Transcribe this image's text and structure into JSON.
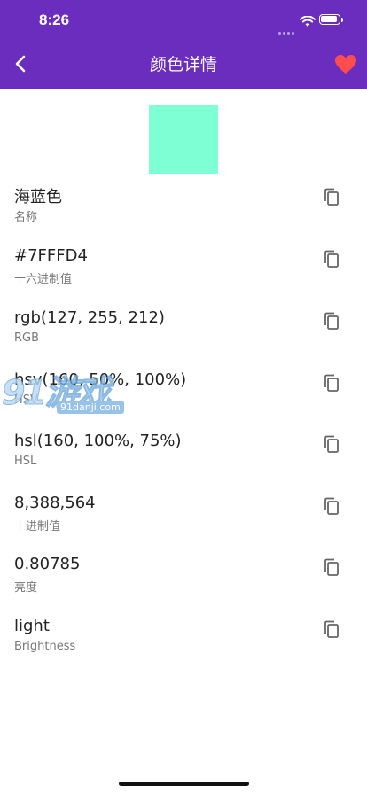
{
  "status_bar": {
    "time": "8:26"
  },
  "header": {
    "title": "颜色详情",
    "heart_color": "#ff4d4d",
    "background": "#6a2dbd"
  },
  "color": {
    "swatch_hex": "#7FFFD4"
  },
  "details": [
    {
      "value": "海蓝色",
      "label": "名称"
    },
    {
      "value": "#7FFFD4",
      "label": "十六进制值"
    },
    {
      "value": "rgb(127, 255, 212)",
      "label": "RGB"
    },
    {
      "value": "hsv(160, 50%, 100%)",
      "label": "HSV"
    },
    {
      "value": "hsl(160, 100%, 75%)",
      "label": "HSL"
    },
    {
      "value": "8,388,564",
      "label": "十进制值"
    },
    {
      "value": "0.80785",
      "label": "亮度"
    },
    {
      "value": "light",
      "label": "Brightness"
    }
  ],
  "icons": {
    "back": "chevron-left-icon",
    "favorite": "heart-icon",
    "copy": "copy-icon"
  },
  "watermark": {
    "big": "91游戏",
    "small": "91danji.com"
  }
}
